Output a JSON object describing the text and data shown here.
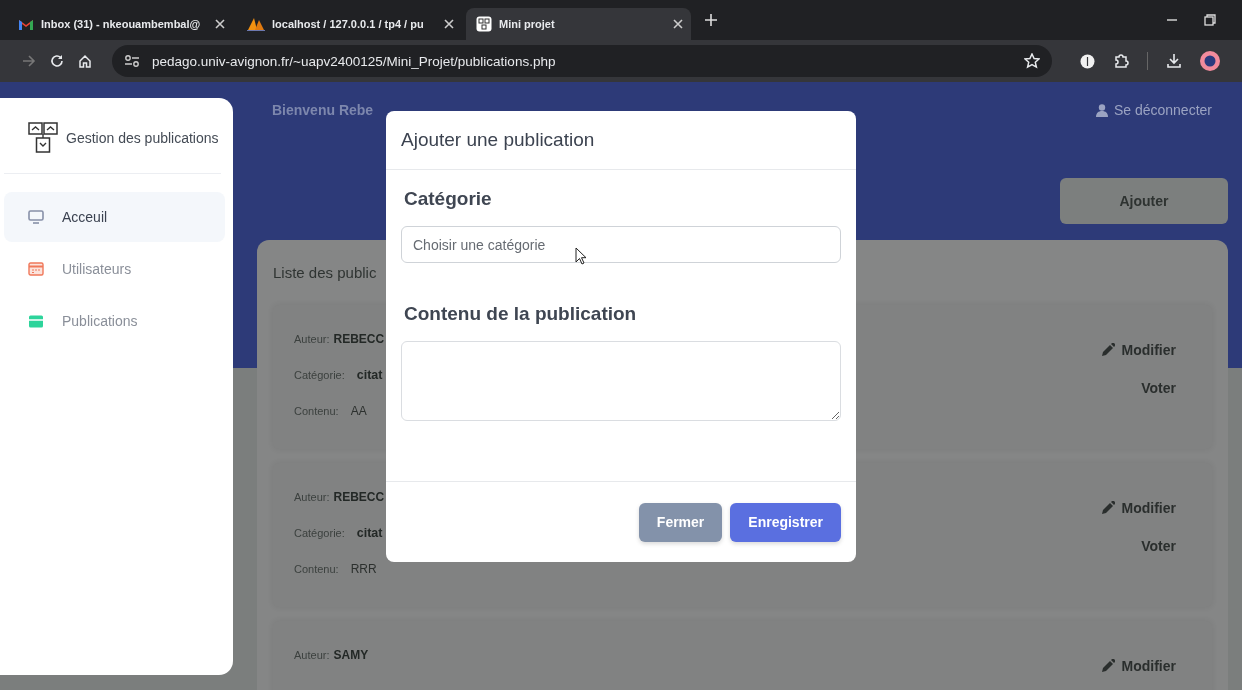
{
  "browser": {
    "tabs": [
      {
        "title": "Inbox (31) - nkeouambembal@",
        "kind": "mail",
        "selected": false
      },
      {
        "title": "localhost / 127.0.0.1 / tp4 / pu",
        "kind": "database",
        "selected": false
      },
      {
        "title": "Mini projet",
        "kind": "page",
        "selected": true
      }
    ],
    "address": "pedago.univ-avignon.fr/~uapv2400125/Mini_Projet/publications.php"
  },
  "sidebar": {
    "brand": "Gestion des publications",
    "items": [
      {
        "label": "Acceuil",
        "kind": "monitor",
        "selected": true
      },
      {
        "label": "Utilisateurs",
        "kind": "calendar",
        "selected": false
      },
      {
        "label": "Publications",
        "kind": "card",
        "selected": false
      }
    ]
  },
  "header": {
    "greeting": "Bienvenu Rebe",
    "logout": "Se déconnecter",
    "add_button": "Ajouter"
  },
  "list": {
    "title": "Liste des public",
    "publications": [
      {
        "author_label": "Auteur:",
        "author": "REBECC",
        "category_label": "Catégorie:",
        "category": "citat",
        "content_label": "Contenu:",
        "content": "AA",
        "edit": "Modifier",
        "vote": "Voter"
      },
      {
        "author_label": "Auteur:",
        "author": "REBECC",
        "category_label": "Catégorie:",
        "category": "citat",
        "content_label": "Contenu:",
        "content": "RRR",
        "edit": "Modifier",
        "vote": "Voter"
      },
      {
        "author_label": "Auteur:",
        "author": "SAMY",
        "edit": "Modifier"
      }
    ]
  },
  "modal": {
    "title": "Ajouter une publication",
    "category_label": "Catégorie",
    "category_placeholder": "Choisir une catégorie",
    "content_label": "Contenu de la publication",
    "buttons": [
      {
        "label": "Fermer",
        "kind": "secondary"
      },
      {
        "label": "Enregistrer",
        "kind": "primary"
      }
    ]
  }
}
